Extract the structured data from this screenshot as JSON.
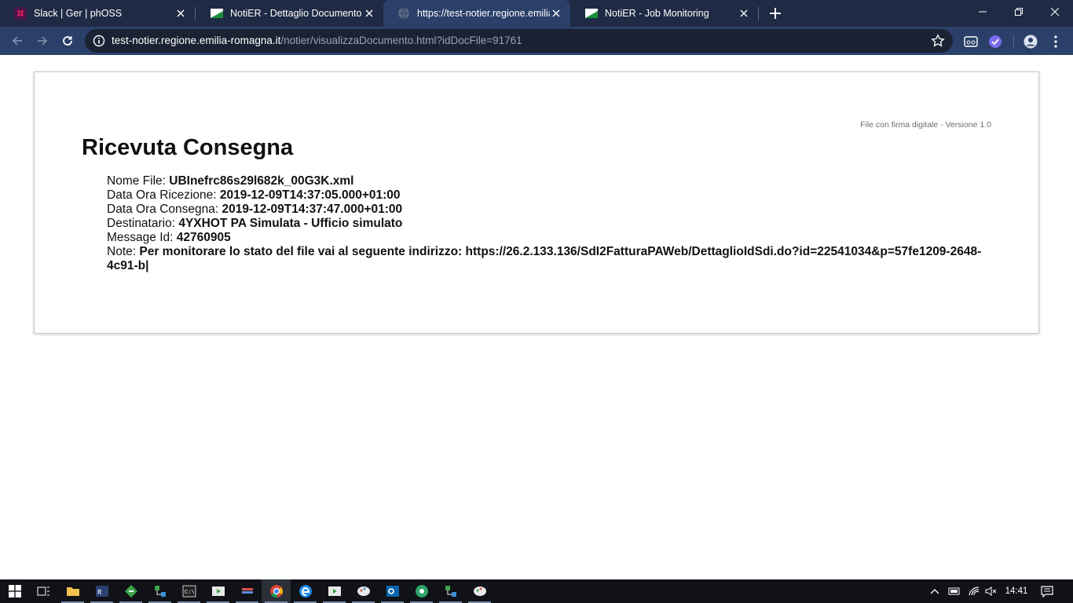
{
  "browser": {
    "tabs": [
      {
        "title": "Slack | Ger | phOSS",
        "active": false,
        "favicon": "slack-icon"
      },
      {
        "title": "NotiER - Dettaglio Documento",
        "active": false,
        "favicon": "notier-flag-icon"
      },
      {
        "title": "https://test-notier.regione.emilia",
        "active": true,
        "favicon": "globe-icon"
      },
      {
        "title": "NotiER - Job Monitoring",
        "active": false,
        "favicon": "notier-flag-icon"
      }
    ],
    "url_host": "test-notier.regione.emilia-romagna.it",
    "url_path": "/notier/visualizzaDocumento.html?idDocFile=91761",
    "colors": {
      "tabstrip": "#1f2a44",
      "toolbar": "#2a4068",
      "omnibox": "#1a2233"
    }
  },
  "document": {
    "version_note": "File con firma digitale - Versione 1.0",
    "title": "Ricevuta Consegna",
    "fields": [
      {
        "label": "Nome File:",
        "value": "UBInefrc86s29l682k_00G3K.xml"
      },
      {
        "label": "Data Ora Ricezione:",
        "value": "2019-12-09T14:37:05.000+01:00"
      },
      {
        "label": "Data Ora Consegna:",
        "value": "2019-12-09T14:37:47.000+01:00"
      },
      {
        "label": "Destinatario:",
        "value": "4YXHOT PA Simulata - Ufficio simulato"
      },
      {
        "label": "Message Id:",
        "value": "42760905"
      },
      {
        "label": "Note:",
        "value": "Per monitorare lo stato del file vai al seguente indirizzo: https://26.2.133.136/SdI2FatturaPAWeb/DettaglioIdSdi.do?id=22541034&p=57fe1209-2648-4c91-b|"
      }
    ]
  },
  "taskbar": {
    "clock": "14:41",
    "apps": [
      "start-icon",
      "task-view-icon",
      "file-explorer-icon",
      "app-icon",
      "app-icon",
      "app-icon",
      "cmd-icon",
      "app-icon",
      "app-icon",
      "chrome-icon",
      "edge-icon",
      "app-icon",
      "app-icon",
      "outlook-icon",
      "app-icon",
      "app-icon",
      "app-icon"
    ]
  }
}
